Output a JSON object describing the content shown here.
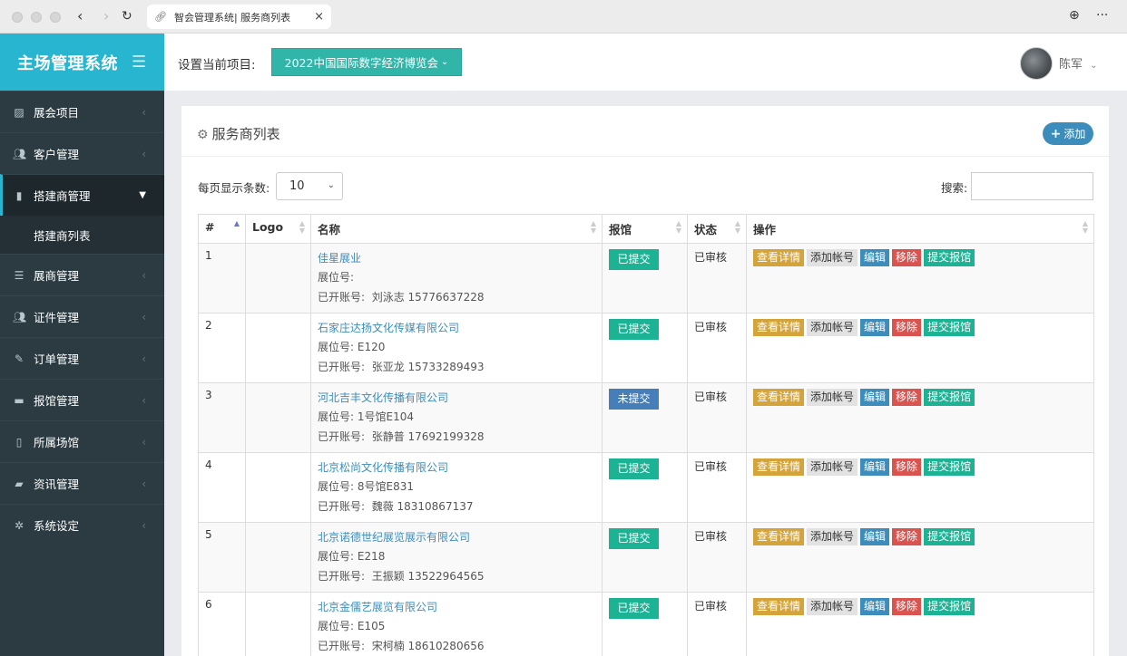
{
  "browser": {
    "tab_title": "智会管理系统| 服务商列表",
    "tab_close": "×",
    "back": "‹",
    "forward": "›",
    "reload": "↻",
    "globe": "⊕",
    "more": "···"
  },
  "sidebar": {
    "brand": "主场管理系统",
    "items": [
      {
        "label": "展会项目",
        "icon": "image-icon"
      },
      {
        "label": "客户管理",
        "icon": "users-icon"
      },
      {
        "label": "搭建商管理",
        "icon": "building-icon",
        "active": true
      },
      {
        "label": "展商管理",
        "icon": "list-icon"
      },
      {
        "label": "证件管理",
        "icon": "users-icon"
      },
      {
        "label": "订单管理",
        "icon": "pencil-icon"
      },
      {
        "label": "报馆管理",
        "icon": "truck-icon"
      },
      {
        "label": "所属场馆",
        "icon": "building-icon"
      },
      {
        "label": "资讯管理",
        "icon": "book-icon"
      },
      {
        "label": "系统设定",
        "icon": "gear-icon"
      }
    ],
    "submenu": "搭建商列表"
  },
  "header": {
    "project_label": "设置当前项目:",
    "project_value": "2022中国国际数字经济博览会",
    "user_name": "陈军"
  },
  "box": {
    "title": "服务商列表",
    "add_label": "添加",
    "length_label": "每页显示条数:",
    "length_value": "10",
    "search_label": "搜索:"
  },
  "table": {
    "columns": [
      "#",
      "Logo",
      "名称",
      "报馆",
      "状态",
      "操作"
    ],
    "booth_prefix": "展位号:",
    "account_prefix": "已开账号:",
    "actions": {
      "detail": "查看详情",
      "account": "添加帐号",
      "edit": "编辑",
      "remove": "移除",
      "submit": "提交报馆"
    },
    "rows": [
      {
        "no": "1",
        "name": "佳星展业",
        "booth": "",
        "account": "刘泳志 15776637228",
        "report": "已提交",
        "report_ok": true,
        "status": "已审核"
      },
      {
        "no": "2",
        "name": "石家庄达扬文化传媒有限公司",
        "booth": "E120",
        "account": "张亚龙 15733289493",
        "report": "已提交",
        "report_ok": true,
        "status": "已审核"
      },
      {
        "no": "3",
        "name": "河北吉丰文化传播有限公司",
        "booth": "1号馆E104",
        "account": "张静普 17692199328",
        "report": "未提交",
        "report_ok": false,
        "status": "已审核"
      },
      {
        "no": "4",
        "name": "北京松尚文化传播有限公司",
        "booth": "8号馆E831",
        "account": "魏薇 18310867137",
        "report": "已提交",
        "report_ok": true,
        "status": "已审核"
      },
      {
        "no": "5",
        "name": "北京诺德世纪展览展示有限公司",
        "booth": "E218",
        "account": "王振颖 13522964565",
        "report": "已提交",
        "report_ok": true,
        "status": "已审核"
      },
      {
        "no": "6",
        "name": "北京金儒艺展览有限公司",
        "booth": "E105",
        "account": "宋柯楠 18610280656",
        "report": "已提交",
        "report_ok": true,
        "status": "已审核"
      }
    ]
  }
}
